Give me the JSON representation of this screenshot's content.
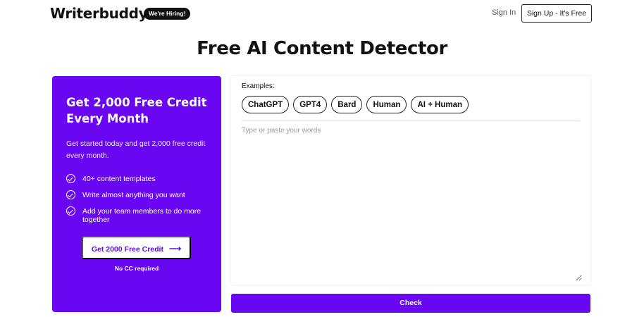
{
  "header": {
    "logo_text": "Writerbuddy",
    "hiring_badge": "We're Hiring!",
    "sign_in": "Sign In",
    "sign_up": "Sign Up - It's Free"
  },
  "page_title": "Free AI Content Detector",
  "promo": {
    "heading": "Get 2,000 Free Credit Every Month",
    "text": "Get started today and get 2,000 free credit every month.",
    "features": [
      {
        "label": "40+ content templates",
        "icon": "check-circle-icon"
      },
      {
        "label": "Write almost anything you want",
        "icon": "check-circle-icon"
      },
      {
        "label": "Add your team members to do more together",
        "icon": "check-circle-icon"
      }
    ],
    "cta_label": "Get 2000 Free Credit",
    "cta_arrow": "⟶",
    "no_cc": "No CC required"
  },
  "detector": {
    "examples_label": "Examples:",
    "examples": [
      "ChatGPT",
      "GPT4",
      "Bard",
      "Human",
      "AI + Human"
    ],
    "input_placeholder": "Type or paste your words",
    "input_value": "",
    "check_label": "Check"
  },
  "colors": {
    "brand_purple": "#6a07f2",
    "text_dark": "#111111",
    "background": "#ffffff"
  }
}
